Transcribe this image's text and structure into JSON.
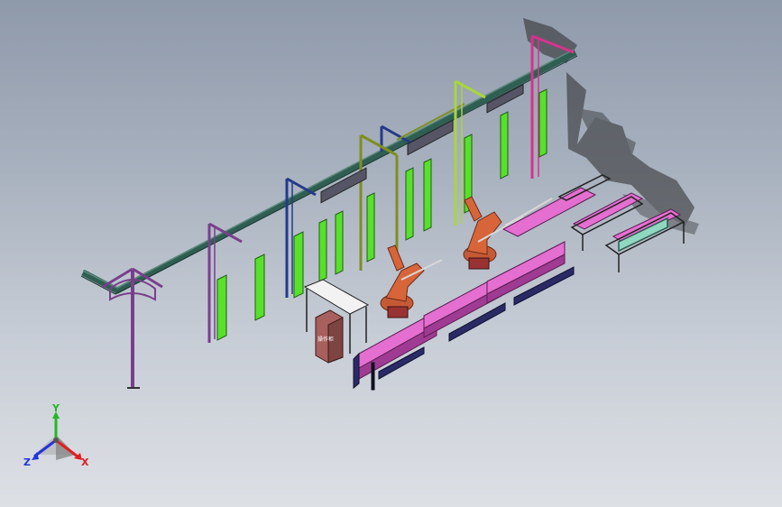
{
  "viewport": {
    "background_top": "#8e99aa",
    "background_bottom": "#dde0e5"
  },
  "colors": {
    "rail": "#2f5e52",
    "purple_frame": "#7a3f8c",
    "blue_frame": "#243a8a",
    "olive_frame": "#7f8e22",
    "lime_frame": "#a9d63a",
    "magenta_frame": "#d7338c",
    "green_panel": "#58e12b",
    "pink_table": "#e46fd0",
    "robot_orange": "#d8653a",
    "cabinet": "#a7605d",
    "shadow": "#2a2a2a"
  },
  "scene": {
    "cabinet_text": "操作柜"
  },
  "triad": {
    "x_label": "X",
    "y_label": "Y",
    "z_label": "Z",
    "x_color": "#e02020",
    "y_color": "#22b822",
    "z_color": "#2233dd"
  }
}
